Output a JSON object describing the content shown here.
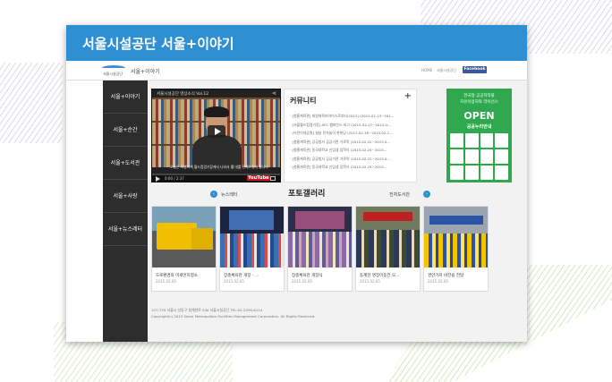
{
  "header": {
    "title": "서울시설공단 서울+이야기"
  },
  "topnav": {
    "logo_text": "서울시설공단",
    "site_name": "서울+이야기",
    "breadcrumb_home": "HOME",
    "breadcrumb_site": "서울시설공단",
    "facebook_label": "Facebook"
  },
  "sidebar": {
    "items": [
      {
        "label": "서울+이야기"
      },
      {
        "label": "서울+순간"
      },
      {
        "label": "서울+도서관"
      },
      {
        "label": "서울+사랑"
      },
      {
        "label": "서울+뉴스레터"
      }
    ]
  },
  "video": {
    "title": "서울시설공단 영상소식 Vol.12",
    "subtitle": "오늘은 특별하게 월드컵경기장에서 나와서 웰 대를 전해드릴까 합니다",
    "time": "0:00 / 2:37",
    "brand": "YouTube",
    "progress": 0
  },
  "community": {
    "title": "커뮤니티",
    "items": [
      "· [첨홍체육관] 회원체육비아이스로부터(2015) (2015.02.13~201...",
      "· [서울월드컵경기장] AFC 챔피언스 리그 (2015.02.17~2015.0...",
      "· [어린이대공원] 설날 민속놀이 한마당 (2015.02.18~2015.02.2...",
      "· [첨홍체육관] 공공청사 공공기관 가로막 (2015.02.22~2015.0...",
      "· [첨홍체육관] 동국대학교 신입생 입학식 (2015.02.25~2015...",
      "· [첨홍체육관] 공공청사 공공기관 가로막 (2015.02.22~2015.0...",
      "· [첨홍체육관] 동국대학교 신입생 입학식 (2015.02.25~2015..."
    ]
  },
  "banner": {
    "line1": "한국형 공공저작물",
    "line2": "자유이용허락 라이선스",
    "open": "OPEN",
    "sub": "공공누리안내"
  },
  "gallery": {
    "prev_label": "뉴스레터",
    "title": "포토갤러리",
    "next_label": "전자도서관",
    "photos": [
      {
        "caption": "도로환경의 미세먼지청소",
        "date": "2015.02.05"
      },
      {
        "caption": "장충체육관 개장 - ...",
        "date": "2015.02.05"
      },
      {
        "caption": "장충체육관 개장식",
        "date": "2015.02.05"
      },
      {
        "caption": "동계한 명장이동전 모...",
        "date": "2015.02.05"
      },
      {
        "caption": "경인가치 비전을 전달",
        "date": "2015.02.05"
      }
    ]
  },
  "footer": {
    "line1": "127-739 서울시 성동구 청계천로 540 서울시설공단 TEL:02-2290-6114",
    "line2": "Copyright(c) 2015 Seoul Metropolitan Facilities Management Corporation. All Rights Reserved."
  },
  "colors": {
    "titlebar": "#2e8fd3",
    "sidebar": "#2d2d2d",
    "banner": "#2fa84f",
    "facebook": "#3b5998"
  }
}
